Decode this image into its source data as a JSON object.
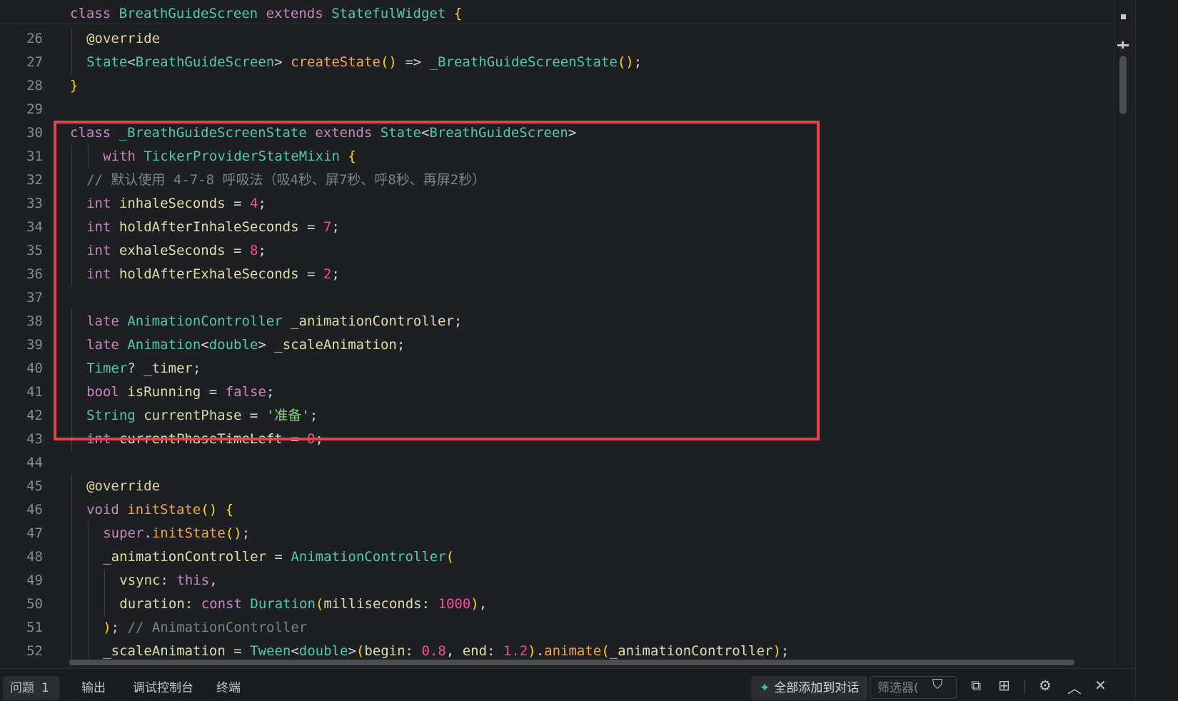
{
  "editor": {
    "sticky_header": "class BreathGuideScreen extends StatefulWidget {",
    "line_numbers": [
      "26",
      "27",
      "28",
      "29",
      "30",
      "31",
      "32",
      "33",
      "34",
      "35",
      "36",
      "37",
      "38",
      "39",
      "40",
      "41",
      "42",
      "43",
      "44",
      "45",
      "46",
      "47",
      "48",
      "49",
      "50",
      "51",
      "52"
    ],
    "lines": [
      "@override",
      "State<BreathGuideScreen> createState() => _BreathGuideScreenState();",
      "}",
      "",
      "class _BreathGuideScreenState extends State<BreathGuideScreen>",
      "with TickerProviderStateMixin {",
      "// 默认使用 4-7-8 呼吸法（吸4秒、屏7秒、呼8秒、再屏2秒）",
      "int inhaleSeconds = 4;",
      "int holdAfterInhaleSeconds = 7;",
      "int exhaleSeconds = 8;",
      "int holdAfterExhaleSeconds = 2;",
      "",
      "late AnimationController _animationController;",
      "late Animation<double> _scaleAnimation;",
      "Timer? _timer;",
      "bool isRunning = false;",
      "String currentPhase = '准备';",
      "int currentPhaseTimeLeft = 0;",
      "",
      "@override",
      "void initState() {",
      "super.initState();",
      "_animationController = AnimationController(",
      "vsync: this,",
      "duration: const Duration(milliseconds: 1000),",
      "); // AnimationController",
      "_scaleAnimation = Tween<double>(begin: 0.8, end: 1.2).animate(_animationController);"
    ]
  },
  "bottom_panel": {
    "tabs": [
      "问题",
      "输出",
      "调试控制台",
      "终端"
    ],
    "problems_count": "1",
    "add_all_label": "全部添加到对话",
    "filter_placeholder": "筛选器(",
    "icons": [
      "filter-icon",
      "copy-icon",
      "layout-icon",
      "settings-icon",
      "chevron-up-icon",
      "close-icon"
    ]
  },
  "colors": {
    "background": "#1e1f22",
    "highlight_border": "#e5434b",
    "keyword": "#c586c0",
    "type": "#4ec9b0",
    "number": "#f14d98",
    "string": "#7ed97e"
  }
}
